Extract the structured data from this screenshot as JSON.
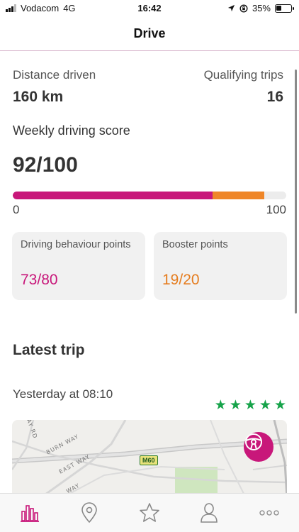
{
  "status": {
    "carrier": "Vodacom",
    "network": "4G",
    "time": "16:42",
    "battery": "35%",
    "battery_level": 0.35,
    "icons": [
      "signal-icon",
      "location-arrow-icon",
      "rotation-lock-icon",
      "battery-icon"
    ]
  },
  "header": {
    "title": "Drive"
  },
  "stats": {
    "distance_label": "Distance driven",
    "distance_value": "160 km",
    "trips_label": "Qualifying trips",
    "trips_value": "16"
  },
  "score": {
    "label": "Weekly driving score",
    "value": "92/100",
    "behaviour_points": 73,
    "booster_points": 19,
    "max": 100,
    "scale_min": "0",
    "scale_max": "100",
    "behaviour_color": "#c8177a",
    "booster_color": "#ef8628"
  },
  "cards": {
    "behaviour": {
      "label": "Driving behaviour points",
      "value": "73/80"
    },
    "booster": {
      "label": "Booster points",
      "value": "19/20"
    }
  },
  "latest_trip": {
    "title": "Latest trip",
    "time": "Yesterday at 08:10",
    "rating": 5,
    "rating_max": 5,
    "star_color": "#16a34a"
  },
  "map": {
    "roads": [
      "WAY RD",
      "BURN WAY",
      "EAST WAY",
      "WAY"
    ],
    "route_shield": "M60",
    "badge_icon": "steering-wheel-icon"
  },
  "tabs": [
    {
      "icon": "bar-chart-icon",
      "active": true
    },
    {
      "icon": "map-pin-icon",
      "active": false
    },
    {
      "icon": "star-icon",
      "active": false
    },
    {
      "icon": "profile-icon",
      "active": false
    },
    {
      "icon": "more-icon",
      "active": false
    }
  ]
}
